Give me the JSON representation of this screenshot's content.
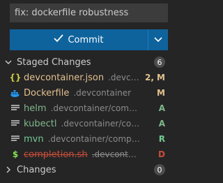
{
  "commit_message": {
    "value": "fix: dockerfile robustness"
  },
  "commit_button": {
    "label": "Commit"
  },
  "staged": {
    "title": "Staged Changes",
    "count": "6",
    "files": [
      {
        "icon": "json-icon",
        "name": "devcontainer.json",
        "path": ".devcontainer",
        "status": "2, M"
      },
      {
        "icon": "docker-icon",
        "name": "Dockerfile",
        "path": ".devcontainer",
        "status": "M"
      },
      {
        "icon": "file-icon",
        "name": "helm",
        "path": ".devcontainer/completions",
        "status": "A"
      },
      {
        "icon": "file-icon",
        "name": "kubectl",
        "path": ".devcontainer/completions",
        "status": "A"
      },
      {
        "icon": "file-icon",
        "name": "mvn",
        "path": ".devcontainer/completions",
        "status": "R"
      },
      {
        "icon": "shell-icon",
        "name": "completion.sh",
        "path": ".devcontainer/li...",
        "status": "D"
      }
    ]
  },
  "changes": {
    "title": "Changes",
    "count": "0"
  },
  "colors": {
    "accent": "#0e639c",
    "added": "#81b88b",
    "modified": "#e2c08d",
    "deleted": "#c74e39",
    "renamed": "#73c991"
  }
}
